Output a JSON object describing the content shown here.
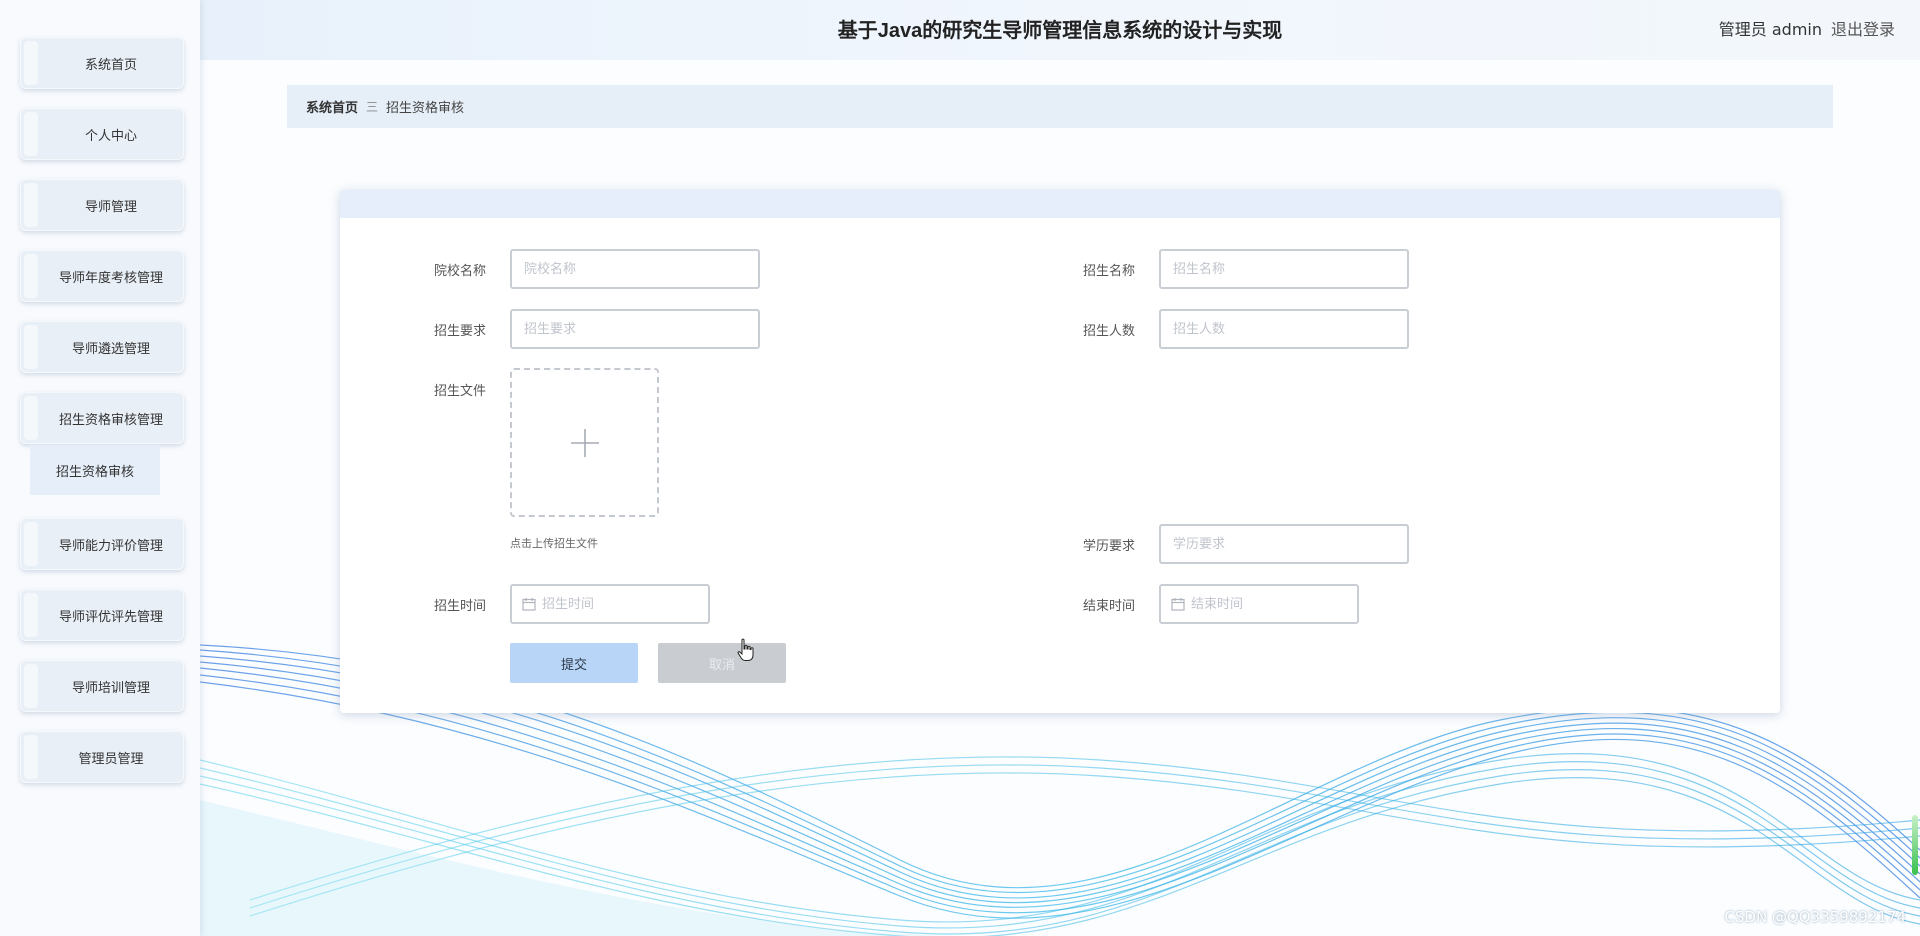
{
  "header": {
    "title": "基于Java的研究生导师管理信息系统的设计与实现",
    "user": "管理员 admin",
    "logout": "退出登录"
  },
  "sidebar": {
    "items": [
      {
        "label": "系统首页"
      },
      {
        "label": "个人中心"
      },
      {
        "label": "导师管理"
      },
      {
        "label": "导师年度考核管理"
      },
      {
        "label": "导师遴选管理"
      },
      {
        "label": "招生资格审核管理"
      },
      {
        "label": "导师能力评价管理"
      },
      {
        "label": "导师评优评先管理"
      },
      {
        "label": "导师培训管理"
      },
      {
        "label": "管理员管理"
      }
    ],
    "submenu": {
      "label": "招生资格审核"
    }
  },
  "breadcrumb": {
    "home": "系统首页",
    "separator": "三",
    "current": "招生资格审核"
  },
  "form": {
    "school_name": {
      "label": "院校名称",
      "placeholder": "院校名称",
      "value": ""
    },
    "enroll_name": {
      "label": "招生名称",
      "placeholder": "招生名称",
      "value": ""
    },
    "enroll_req": {
      "label": "招生要求",
      "placeholder": "招生要求",
      "value": ""
    },
    "enroll_count": {
      "label": "招生人数",
      "placeholder": "招生人数",
      "value": ""
    },
    "enroll_file": {
      "label": "招生文件",
      "hint": "点击上传招生文件"
    },
    "education_req": {
      "label": "学历要求",
      "placeholder": "学历要求",
      "value": ""
    },
    "start_time": {
      "label": "招生时间",
      "placeholder": "招生时间",
      "value": ""
    },
    "end_time": {
      "label": "结束时间",
      "placeholder": "结束时间",
      "value": ""
    },
    "submit_label": "提交",
    "cancel_label": "取消"
  },
  "colors": {
    "primary_button": "#b8d5f8",
    "cancel_button": "#c9ccd1",
    "breadcrumb_bg": "#e6eef8",
    "menu_bg": "#e9eff7"
  },
  "icons": {
    "upload": "plus-icon",
    "date": "calendar-icon",
    "pointer": "hand-pointer-icon"
  },
  "watermark": "CSDN @QQ3359892174"
}
